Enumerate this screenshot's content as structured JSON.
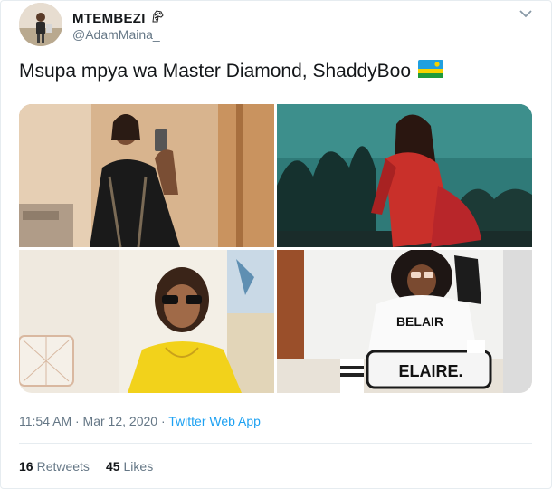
{
  "tweet": {
    "author_name": "MTEMBEZI",
    "author_handle": "@AdamMaina_",
    "text": "Msupa mpya wa Master Diamond, ShaddyBoo",
    "timestamp": "11:54 AM · Mar 12, 2020 · ",
    "source": "Twitter Web App",
    "retweets_count": "16",
    "retweets_label": "Retweets",
    "likes_count": "45",
    "likes_label": "Likes",
    "flag_icon": "rwanda-flag-icon",
    "name_icon": "zebra-emoji-icon",
    "photos": [
      {
        "icon": "photo-mirror-selfie"
      },
      {
        "icon": "photo-red-lace-dress"
      },
      {
        "icon": "photo-yellow-top-sunglasses"
      },
      {
        "icon": "photo-belaire-sweater"
      }
    ],
    "photo_print_1": "BELAIR",
    "photo_print_2": "ELAIRE."
  },
  "colors": {
    "link": "#1da1f2",
    "secondary_text": "#657786",
    "primary_text": "#14171a",
    "border": "#e6ecf0"
  }
}
